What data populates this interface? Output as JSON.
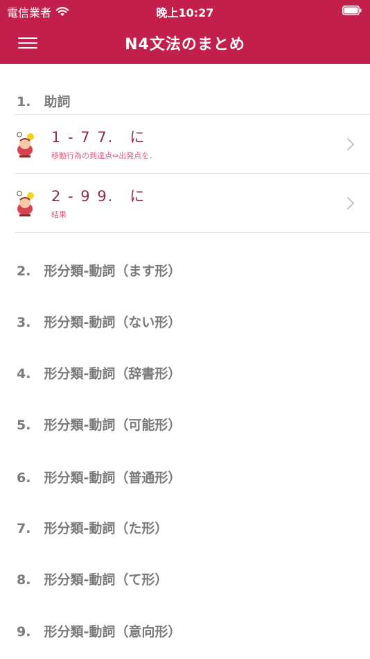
{
  "status_bar": {
    "carrier": "電信業者",
    "time": "晚上10:27",
    "wifi_icon": "wifi-icon",
    "battery_icon": "battery-icon"
  },
  "nav": {
    "title": "N4文法のまとめ",
    "menu_icon": "hamburger-menu-icon"
  },
  "colors": {
    "brand": "#c21f4d",
    "item_title": "#8e2a53",
    "item_subtitle": "#d9607d",
    "section_text": "#7a7a7a"
  },
  "sections": [
    {
      "label": "1.　助詞",
      "items": [
        {
          "title": "1 - 7 7.　に",
          "subtitle": "移動行為の到達点⇔出発点を．"
        },
        {
          "title": "2 - 9 9.　に",
          "subtitle": "結果"
        }
      ]
    },
    {
      "label": "2.　形分類-動詞（ます形）"
    },
    {
      "label": "3.　形分類-動詞（ない形）"
    },
    {
      "label": "4.　形分類-動詞（辞書形）"
    },
    {
      "label": "5.　形分類-動詞（可能形）"
    },
    {
      "label": "6.　形分類-動詞（普通形）"
    },
    {
      "label": "7.　形分類-動詞（た形）"
    },
    {
      "label": "8.　形分類-動詞（て形）"
    },
    {
      "label": "9.　形分類-動詞（意向形）"
    }
  ]
}
